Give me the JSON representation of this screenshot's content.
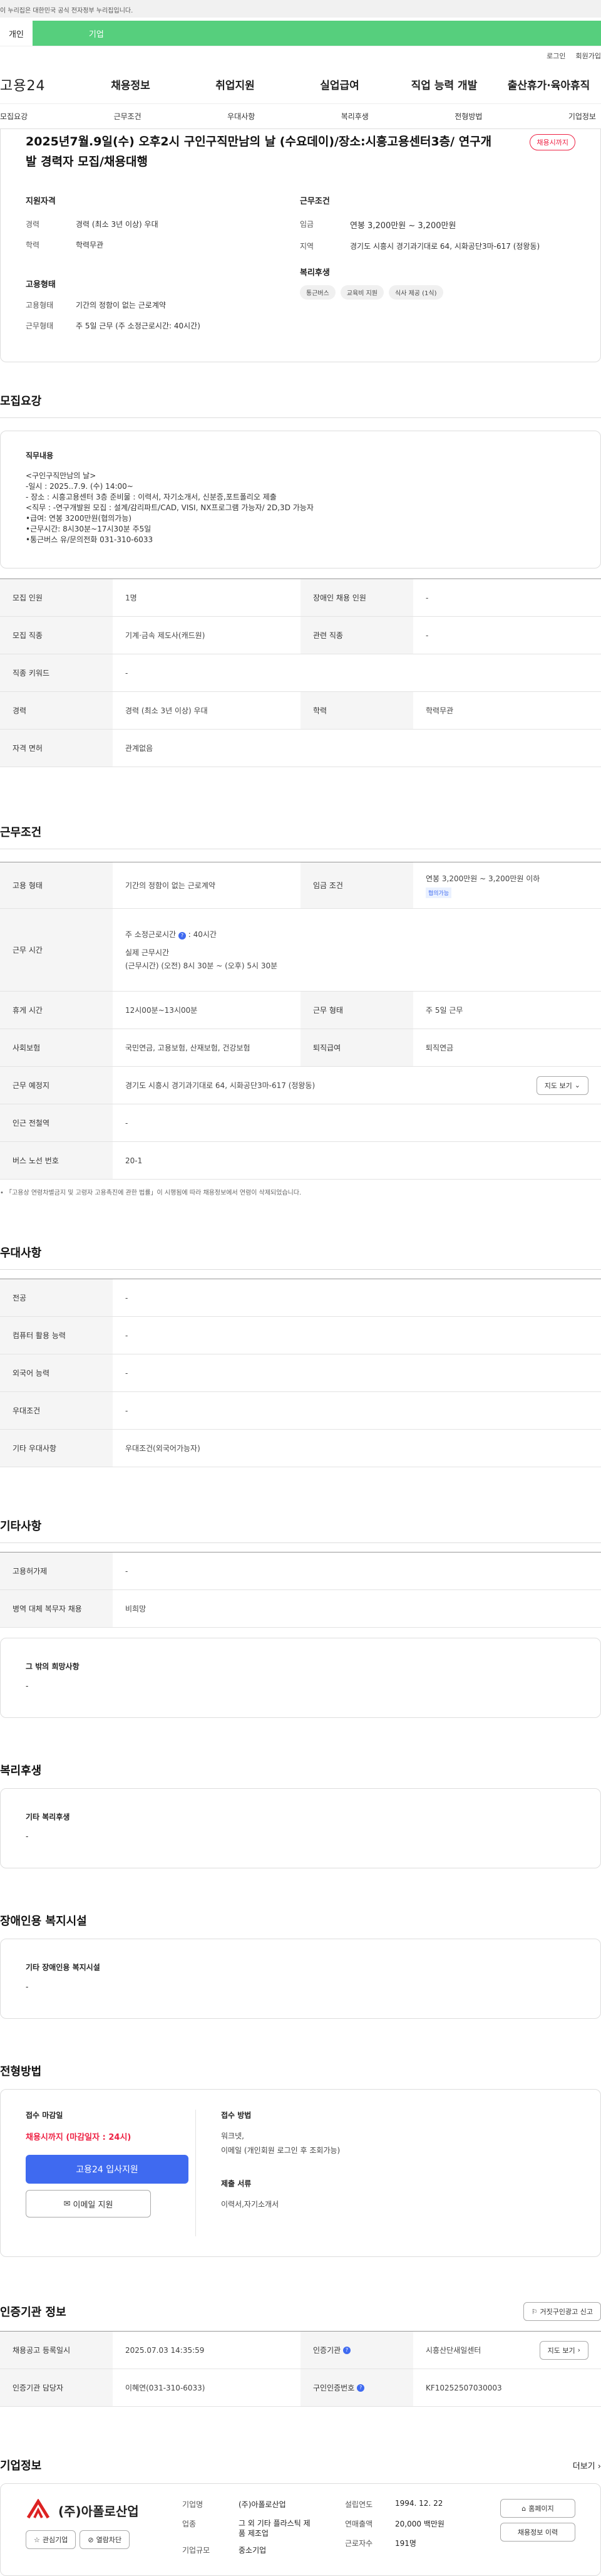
{
  "gov_banner": "이 누리집은 대한민국 공식 전자정부 누리집입니다.",
  "tabs": [
    "개인",
    "기업"
  ],
  "util": [
    "로그인",
    "회원가입"
  ],
  "logo": "고용24",
  "gnb": [
    "채용정보",
    "취업지원",
    "실업급여",
    "직업 능력 개발",
    "출산휴가·육아휴직"
  ],
  "subnav": [
    "모집요강",
    "근무조건",
    "우대사항",
    "복리후생",
    "전형방법",
    "기업정보"
  ],
  "summary": {
    "title": "2025년7월.9일(수) 오후2시 구인구직만남의 날 (수요데이)/장소:시흥고용센터3층/ 연구개발 경력자 모집/채용대행",
    "badge": "채용시까지",
    "qual_h": "지원자격",
    "career_l": "경력",
    "career_v": "경력 (최소 3년 이상) 우대",
    "edu_l": "학력",
    "edu_v": "학력무관",
    "work_h": "근무조건",
    "wage_l": "임금",
    "wage_v": "연봉 3,200만원 ~ 3,200만원",
    "loc_l": "지역",
    "loc_v": "경기도 시흥시 경기과기대로 64, 시화공단3마-617 (정왕동)",
    "emp_h": "고용형태",
    "emp_l": "고용형태",
    "emp_v": "기간의 정함이 없는 근로계약",
    "hours_l": "근무형태",
    "hours_v": "주 5일 근무 (주 소정근로시간: 40시간)",
    "wel_h": "복리후생",
    "wel": [
      "통근버스",
      "교육비 지원",
      "식사 제공 (1식)"
    ]
  },
  "recruit": {
    "h": "모집요강",
    "desc_h": "직무내용",
    "desc": [
      "<구인구직만남의 날>",
      "-일시 : 2025..7.9. (수) 14:00~",
      "  - 장소 : 시흥고용센터 3층 준비물 : 이력서, 자기소개서, 신분증,포트폴리오 제출",
      "<직무 : -연구개발원 모집 : 설계/감리파트/CAD, VISI, NX프로그램 가능자/ 2D,3D 가능자",
      "•급여: 연봉 3200만원(협의가능)",
      "•근무시간: 8시30분~17시30분 주5일",
      "•통근버스 유/문의전화 031-310-6033"
    ],
    "rows": [
      [
        [
          "모집 인원",
          "1명"
        ],
        [
          "장애인 채용 인원",
          "-"
        ]
      ],
      [
        [
          "모집 직종",
          "기계·금속 제도사(캐드원)"
        ],
        [
          "관련 직종",
          "-"
        ]
      ],
      [
        [
          "직종 키워드",
          "-"
        ]
      ],
      [
        [
          "경력",
          "경력 (최소 3년 이상) 우대"
        ],
        [
          "학력",
          "학력무관"
        ]
      ],
      [
        [
          "자격 면허",
          "관계없음"
        ]
      ]
    ]
  },
  "work": {
    "h": "근무조건",
    "emp_l": "고용 형태",
    "emp_v": "기간의 정함이 없는 근로계약",
    "wage_l": "임금 조건",
    "wage_v": "연봉 3,200만원 ~ 3,200만원 이하",
    "wage_tag": "협의가능",
    "time_l": "근무 시간",
    "time_1": "주 소정근로시간",
    "time_1v": ": 40시간",
    "time_2": "실제 근무시간",
    "time_3": "(근무시간) (오전) 8시 30분 ~ (오후) 5시 30분",
    "break_l": "휴게 시간",
    "break_v": "12시00분~13시00분",
    "form_l": "근무 형태",
    "form_v": "주 5일 근무",
    "ins_l": "사회보험",
    "ins_v": "국민연금, 고용보험, 산재보험, 건강보험",
    "ret_l": "퇴직급여",
    "ret_v": "퇴직연금",
    "place_l": "근무 예정지",
    "place_v": "경기도 시흥시 경기과기대로 64, 시화공단3마-617 (정왕동)",
    "map": "지도 보기",
    "sub_l": "인근 전철역",
    "sub_v": "-",
    "bus_l": "버스 노선 번호",
    "bus_v": "20-1",
    "note": "「고용상 연령차별금지 및 고령자 고용촉진에 관한 법률」이 시행됨에 따라 채용정보에서 연령이 삭제되었습니다."
  },
  "pref": {
    "h": "우대사항",
    "rows": [
      [
        "전공",
        "-"
      ],
      [
        "컴퓨터 활용 능력",
        "-"
      ],
      [
        "외국어 능력",
        "-"
      ],
      [
        "우대조건",
        "-"
      ],
      [
        "기타 우대사항",
        "우대조건(외국어가능자)"
      ]
    ]
  },
  "etc": {
    "h": "기타사항",
    "rows": [
      [
        "고용허가제",
        "-"
      ],
      [
        "병역 대체 복무자 채용",
        "비희망"
      ]
    ],
    "box_h": "그 밖의 희망사항",
    "box_v": "-"
  },
  "welfare": {
    "h": "복리후생",
    "box_h": "기타 복리후생",
    "box_v": "-"
  },
  "disab": {
    "h": "장애인용 복지시설",
    "box_h": "기타 장애인용 복지시설",
    "box_v": "-"
  },
  "select": {
    "h": "전형방법",
    "dl_h": "접수 마감일",
    "dl_v": "채용시까지 (마감일자 : 24시)",
    "apply": "고용24 입사지원",
    "email": "이메일 지원",
    "m_h": "접수 방법",
    "m_v1": "워크넷,",
    "m_v2": "이메일 (개인회원 로그인 후 조회가능)",
    "d_h": "제출 서류",
    "d_v": "이력서,자기소개서"
  },
  "cert": {
    "h": "인증기관 정보",
    "report": "거짓구인광고 신고",
    "r1": [
      [
        "채용공고 등록일시",
        "2025.07.03 14:35:59"
      ],
      [
        "인증기관",
        "시흥산단새일센터"
      ]
    ],
    "map": "지도 보기",
    "r2": [
      [
        "인증기관 담당자",
        "이혜연(031-310-6033)"
      ],
      [
        "구인인증번호",
        "KF10252507030003"
      ]
    ]
  },
  "company": {
    "h": "기업정보",
    "more": "더보기",
    "name": "(주)아폴로산업",
    "fav": "관심기업",
    "block": "열람차단",
    "f": [
      [
        "기업명",
        "(주)아폴로산업"
      ],
      [
        "업종",
        "그 외 기타 플라스틱 제품 제조업"
      ],
      [
        "기업규모",
        "중소기업"
      ]
    ],
    "g": [
      [
        "설립연도",
        "1994. 12. 22"
      ],
      [
        "연매출액",
        "20,000 백만원"
      ],
      [
        "근로자수",
        "191명"
      ]
    ],
    "home": "홈페이지",
    "jobs": "채용정보 이력"
  },
  "colors": {
    "green": "#56cf7d",
    "blue": "#3f6af0",
    "red": "#e24"
  }
}
